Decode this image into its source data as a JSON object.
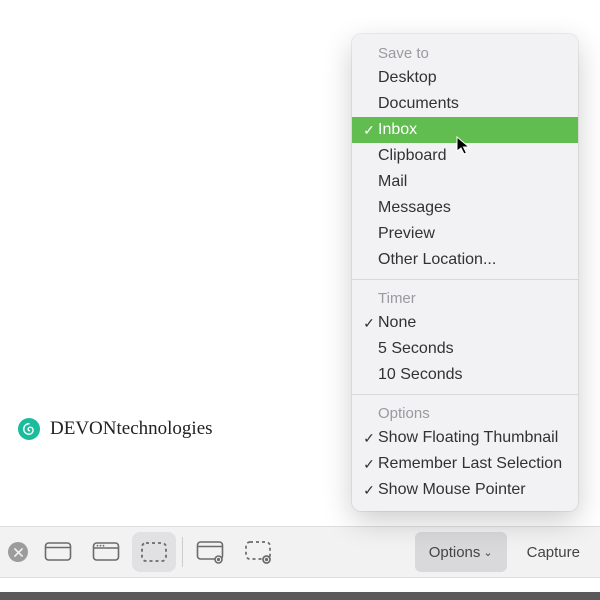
{
  "brand": {
    "name": "DEVONtechnologies"
  },
  "toolbar": {
    "options_label": "Options",
    "capture_label": "Capture"
  },
  "menu": {
    "sections": {
      "save_to": {
        "label": "Save to",
        "items": [
          {
            "label": "Desktop"
          },
          {
            "label": "Documents"
          },
          {
            "label": "Inbox",
            "checked": true,
            "highlight": true
          },
          {
            "label": "Clipboard"
          },
          {
            "label": "Mail"
          },
          {
            "label": "Messages"
          },
          {
            "label": "Preview"
          },
          {
            "label": "Other Location..."
          }
        ]
      },
      "timer": {
        "label": "Timer",
        "items": [
          {
            "label": "None",
            "checked": true
          },
          {
            "label": "5 Seconds"
          },
          {
            "label": "10 Seconds"
          }
        ]
      },
      "options": {
        "label": "Options",
        "items": [
          {
            "label": "Show Floating Thumbnail",
            "checked": true
          },
          {
            "label": "Remember Last Selection",
            "checked": true
          },
          {
            "label": "Show Mouse Pointer",
            "checked": true
          }
        ]
      }
    }
  }
}
